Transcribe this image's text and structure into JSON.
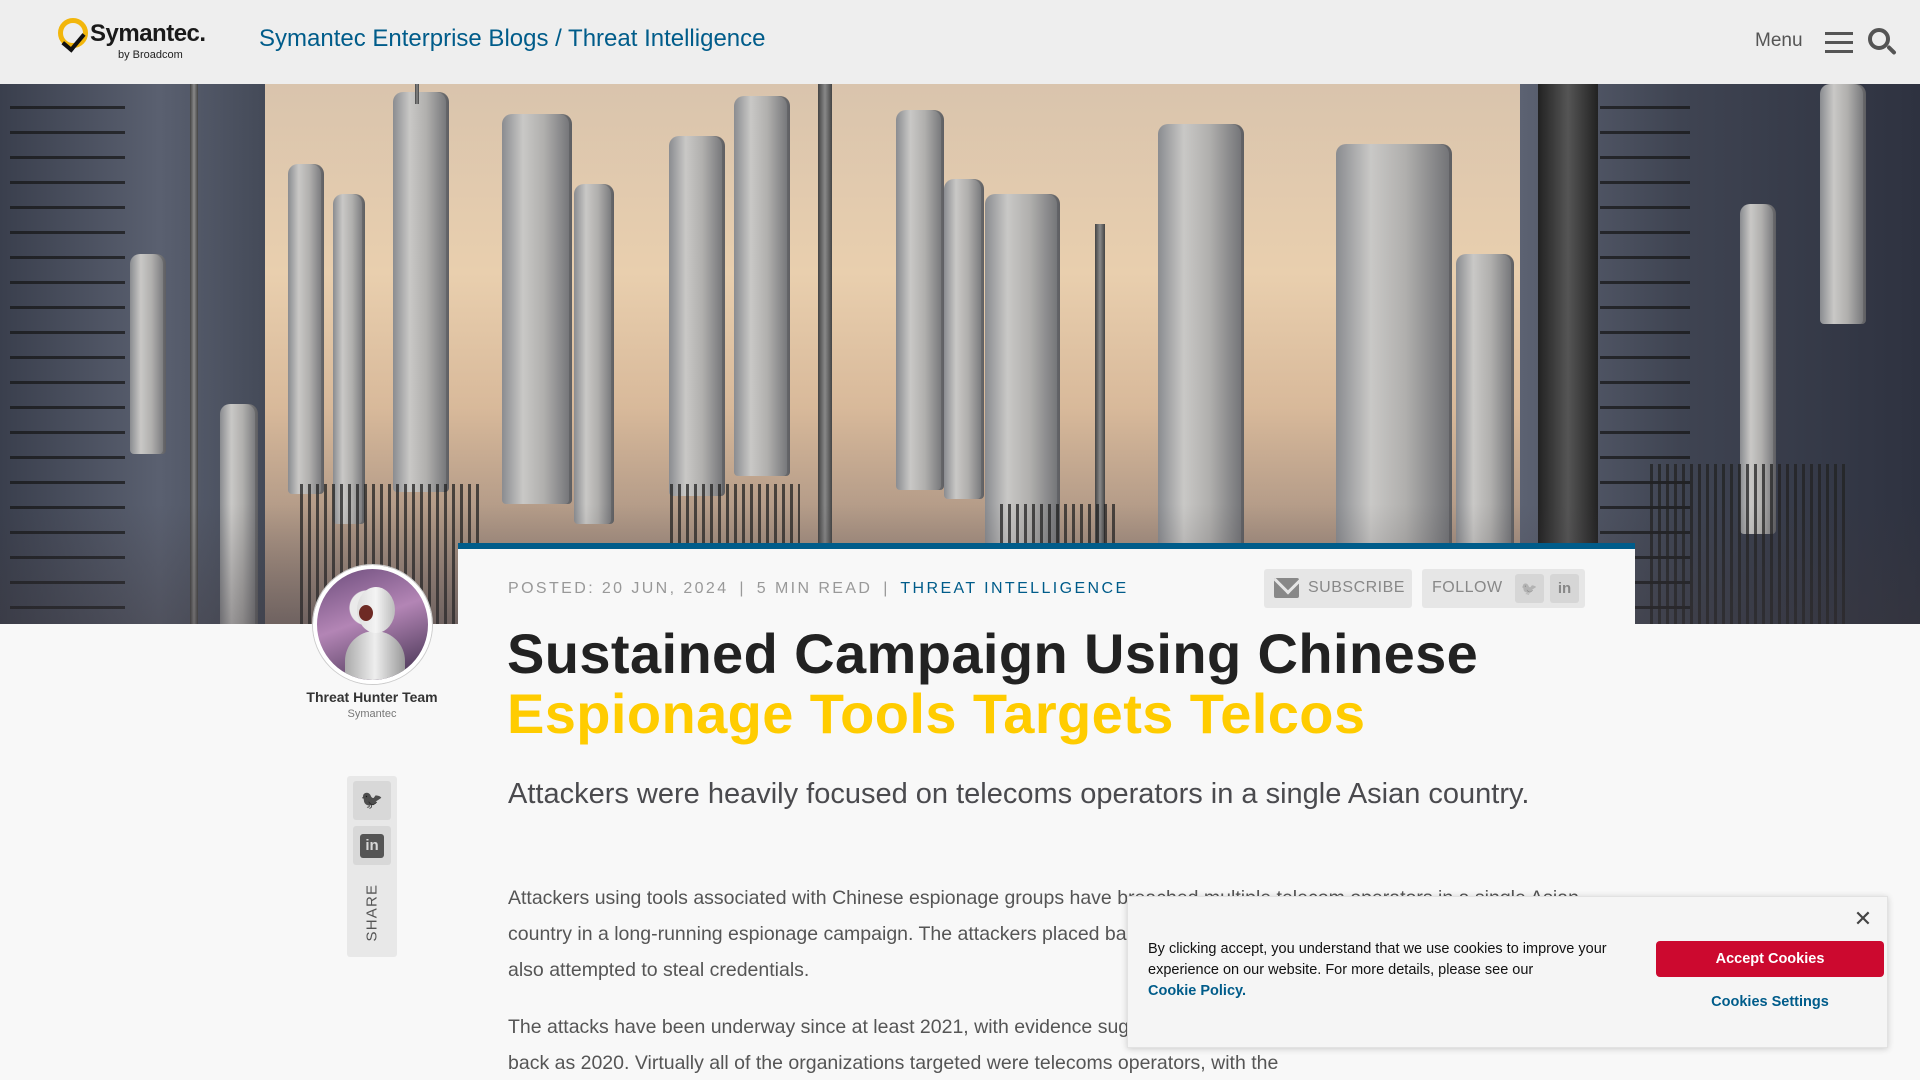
{
  "header": {
    "logo_text": "Symantec.",
    "logo_sub": "by Broadcom",
    "site_title": "Symantec Enterprise Blogs / Threat Intelligence",
    "menu_label": "Menu"
  },
  "article": {
    "meta": {
      "posted": "POSTED: 20 JUN, 2024",
      "read_time": "5 MIN READ",
      "separator": "|",
      "category": "THREAT INTELLIGENCE"
    },
    "subscribe_label": "SUBSCRIBE",
    "follow_label": "FOLLOW",
    "title_line1": "Sustained Campaign Using Chinese",
    "title_line2": "Espionage Tools Targets Telcos",
    "subtitle": "Attackers were heavily focused on telecoms operators in a single Asian country.",
    "paragraphs": [
      "Attackers using tools associated with Chinese espionage groups have breached multiple telecom operators in a single Asian country in a long-running espionage campaign. The attackers placed backdoors on the networks of targeted companies and also attempted to steal credentials.",
      "The attacks have been underway since at least 2021, with evidence suggesting that some of this activity may even date as far back as 2020. Virtually all of the organizations targeted were telecoms operators, with the"
    ]
  },
  "author": {
    "name": "Threat Hunter Team",
    "org": "Symantec"
  },
  "share": {
    "label": "SHARE",
    "twitter_glyph": "🐦",
    "linkedin_glyph": "in"
  },
  "cookie_banner": {
    "text": "By clicking accept, you understand that we use cookies to improve your experience on our website. For more details, please see our",
    "policy_link": "Cookie Policy.",
    "accept_label": "Accept Cookies",
    "settings_label": "Cookies Settings",
    "close_glyph": "✕"
  },
  "colors": {
    "brand_blue": "#005c8a",
    "highlight_yellow": "#ffcc00",
    "accept_red": "#cc092f"
  }
}
